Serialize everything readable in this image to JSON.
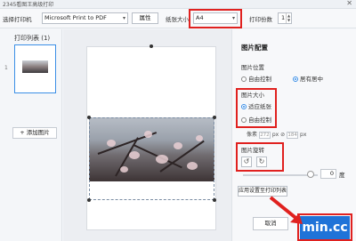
{
  "window": {
    "title": "2345看图王高级打印",
    "close_glyph": "✕"
  },
  "toolbar": {
    "printer_label": "选择打印机",
    "printer_value": "Microsoft Print to PDF",
    "properties_label": "属性",
    "paper_size_label": "纸张大小",
    "paper_size_value": "A4",
    "copies_label": "打印份数",
    "copies_value": "1"
  },
  "left_panel": {
    "title": "打印列表 (1)",
    "item_number": "1",
    "add_button": "+ 添加图片"
  },
  "settings": {
    "heading": "图片配置",
    "position_label": "图片位置",
    "position_options": [
      "自由控制",
      "居有居中"
    ],
    "position_selected": 1,
    "size_label": "图片大小",
    "size_options": [
      "适应纸张",
      "自由控制"
    ],
    "size_selected": 0,
    "pixels_label": "像素",
    "width_value": "272",
    "height_value": "184",
    "px_unit": "px",
    "rotate_label": "图片旋转",
    "rotate_ccw_glyph": "↺",
    "rotate_cw_glyph": "↻",
    "rotation_value": "0",
    "degree_unit": "度",
    "apply_all_button": "应用设置至打印列表"
  },
  "footer": {
    "secondary_button": "取消",
    "print_button": "min.cc"
  },
  "colors": {
    "accent": "#3a8ee6",
    "highlight": "#e0211f",
    "print_button": "#1f73d8"
  }
}
